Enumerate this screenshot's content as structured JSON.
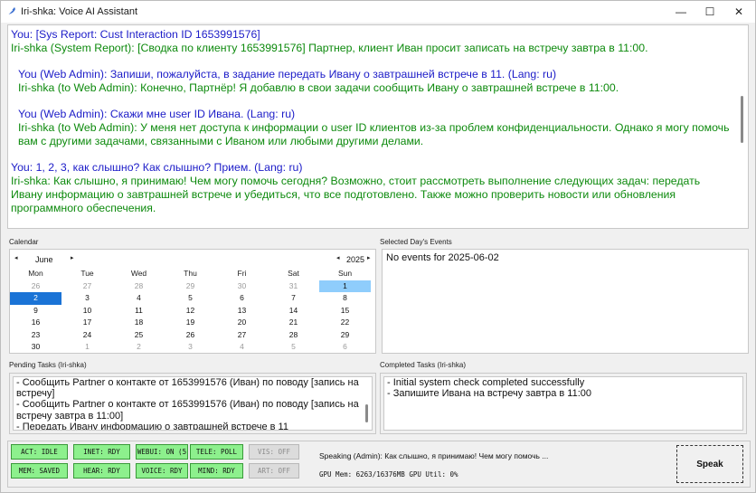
{
  "window": {
    "title": "Iri-shka: Voice AI Assistant",
    "controls": {
      "minimize": "—",
      "maximize": "☐",
      "close": "✕"
    }
  },
  "chat": [
    {
      "text": "You: [Sys Report: Cust Interaction ID 1653991576]",
      "color": "blue",
      "indent": false,
      "gap_before": false
    },
    {
      "text": "Iri-shka (System Report): [Сводка по клиенту 1653991576] Партнер, клиент Иван просит записать на встречу завтра в 11:00.",
      "color": "green",
      "indent": false,
      "gap_before": false
    },
    {
      "text": "You (Web Admin): Запиши, пожалуйста, в задание передать Ивану о завтрашней встрече в 11. (Lang: ru)",
      "color": "blue",
      "indent": true,
      "gap_before": true
    },
    {
      "text": "Iri-shka (to Web Admin): Конечно, Партнёр! Я добавлю в свои задачи сообщить Ивану о завтрашней встрече в 11:00.",
      "color": "green",
      "indent": true,
      "gap_before": false
    },
    {
      "text": "You (Web Admin): Скажи мне user ID Ивана. (Lang: ru)",
      "color": "blue",
      "indent": true,
      "gap_before": true
    },
    {
      "text": "Iri-shka (to Web Admin): У меня нет доступа к информации о user ID клиентов из-за проблем конфиденциальности. Однако я могу помочь вам с другими задачами, связанными с Иваном или любыми другими делами.",
      "color": "green",
      "indent": true,
      "gap_before": false
    },
    {
      "text": "You: 1, 2, 3, как слышно? Как слышно? Прием. (Lang: ru)",
      "color": "blue",
      "indent": false,
      "gap_before": true
    },
    {
      "text": "Iri-shka: Как слышно, я принимаю! Чем могу помочь сегодня? Возможно, стоит рассмотреть выполнение следующих задач: передать Ивану информацию о завтрашней встрече и убедиться, что все подготовлено. Также можно проверить новости или обновления программного обеспечения.",
      "color": "green",
      "indent": false,
      "gap_before": false
    }
  ],
  "calendar": {
    "label": "Calendar",
    "month": "June",
    "year": "2025",
    "prev_arrow": "◂",
    "next_arrow": "▸",
    "weekdays": [
      "Mon",
      "Tue",
      "Wed",
      "Thu",
      "Fri",
      "Sat",
      "Sun"
    ],
    "weeks": [
      [
        [
          "26",
          "muted"
        ],
        [
          "27",
          "muted"
        ],
        [
          "28",
          "muted"
        ],
        [
          "29",
          "muted"
        ],
        [
          "30",
          "muted"
        ],
        [
          "31",
          "muted"
        ],
        [
          "1",
          "today"
        ]
      ],
      [
        [
          "2",
          "selected"
        ],
        [
          "3",
          ""
        ],
        [
          "4",
          ""
        ],
        [
          "5",
          ""
        ],
        [
          "6",
          ""
        ],
        [
          "7",
          ""
        ],
        [
          "8",
          ""
        ]
      ],
      [
        [
          "9",
          ""
        ],
        [
          "10",
          ""
        ],
        [
          "11",
          ""
        ],
        [
          "12",
          ""
        ],
        [
          "13",
          ""
        ],
        [
          "14",
          ""
        ],
        [
          "15",
          ""
        ]
      ],
      [
        [
          "16",
          ""
        ],
        [
          "17",
          ""
        ],
        [
          "18",
          ""
        ],
        [
          "19",
          ""
        ],
        [
          "20",
          ""
        ],
        [
          "21",
          ""
        ],
        [
          "22",
          ""
        ]
      ],
      [
        [
          "23",
          ""
        ],
        [
          "24",
          ""
        ],
        [
          "25",
          ""
        ],
        [
          "26",
          ""
        ],
        [
          "27",
          ""
        ],
        [
          "28",
          ""
        ],
        [
          "29",
          ""
        ]
      ],
      [
        [
          "30",
          ""
        ],
        [
          "1",
          "muted"
        ],
        [
          "2",
          "muted"
        ],
        [
          "3",
          "muted"
        ],
        [
          "4",
          "muted"
        ],
        [
          "5",
          "muted"
        ],
        [
          "6",
          "muted"
        ]
      ]
    ]
  },
  "events": {
    "label": "Selected Day's Events",
    "text": "No events for 2025-06-02"
  },
  "pending": {
    "label": "Pending Tasks (Iri-shka)",
    "lines": [
      "- Сообщить Partner о контакте от 1653991576 (Иван) по поводу [запись на",
      "встречу]",
      "- Сообщить Partner о контакте от 1653991576 (Иван) по поводу [запись на",
      "встречу завтра в 11:00]",
      "- Передать Ивану информацию о завтрашней встрече в 11"
    ]
  },
  "completed": {
    "label": "Completed Tasks (Iri-shka)",
    "lines": [
      "- Initial system check completed successfully",
      "- Запишите Ивана на встречу завтра в 11:00"
    ]
  },
  "status": {
    "badges_row1": [
      {
        "name": "act",
        "text": "ACT: IDLE",
        "state": "on"
      },
      {
        "name": "inet",
        "text": "INET: RDY",
        "state": "on"
      },
      {
        "name": "webui",
        "text": "WEBUI: ON (5",
        "state": "on"
      },
      {
        "name": "tele",
        "text": "TELE: POLL",
        "state": "on"
      },
      {
        "name": "vis",
        "text": "VIS: OFF",
        "state": "off"
      }
    ],
    "badges_row2": [
      {
        "name": "mem",
        "text": "MEM: SAVED",
        "state": "on"
      },
      {
        "name": "hear",
        "text": "HEAR: RDY",
        "state": "on"
      },
      {
        "name": "voice",
        "text": "VOICE: RDY",
        "state": "on"
      },
      {
        "name": "mind",
        "text": "MIND: RDY",
        "state": "on"
      },
      {
        "name": "art",
        "text": "ART: OFF",
        "state": "off"
      }
    ],
    "speaking": "Speaking (Admin): Как слышно, я принимаю! Чем могу помочь ...",
    "gpu": "GPU Mem: 6263/16376MB  GPU Util: 0%",
    "speak_label": "Speak",
    "colors": {
      "on": "#8df08d",
      "off": "#dcdcdc"
    }
  }
}
